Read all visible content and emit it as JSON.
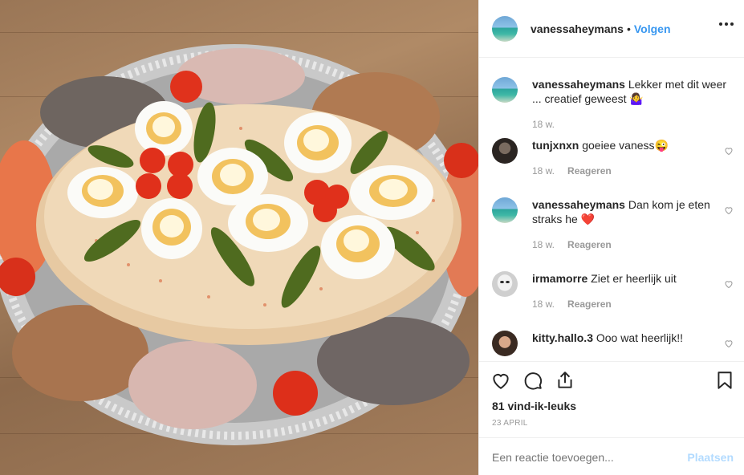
{
  "post": {
    "author": "vanessaheymans",
    "separator": "•",
    "follow_label": "Volgen",
    "image_alt": "Schotel met huzarensalade, eieren, augurken, tomaten, garnalen en vis"
  },
  "comments": [
    {
      "user": "vanessaheymans",
      "text": "Lekker met dit weer ... creatief geweest 🤷‍♀️",
      "time": "18 w.",
      "reply": ""
    },
    {
      "user": "tunjxnxn",
      "text": "goeiee vaness😜",
      "time": "18 w.",
      "reply": "Reageren"
    },
    {
      "user": "vanessaheymans",
      "text": "Dan kom je eten straks he ❤️",
      "time": "18 w.",
      "reply": "Reageren"
    },
    {
      "user": "irmamorre",
      "text": "Ziet er heerlijk uit",
      "time": "18 w.",
      "reply": "Reageren"
    },
    {
      "user": "kitty.hallo.3",
      "text": "Ooo wat heerlijk!!",
      "time": "",
      "reply": ""
    }
  ],
  "actions": {
    "likes": "81 vind-ik-leuks",
    "date": "23 APRIL",
    "icons": [
      "heart-icon",
      "comment-icon",
      "share-icon",
      "bookmark-icon"
    ]
  },
  "add_comment": {
    "placeholder": "Een reactie toevoegen...",
    "post_label": "Plaatsen"
  },
  "colors": {
    "link_blue": "#3897f0",
    "post_disabled": "#b3dbff",
    "muted": "#999999",
    "text": "#262626"
  }
}
